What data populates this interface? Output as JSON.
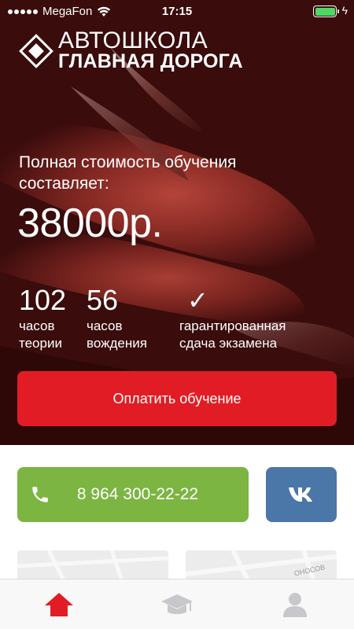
{
  "status_bar": {
    "carrier": "MegaFon",
    "time": "17:15",
    "battery_level": 1.0
  },
  "logo": {
    "line1": "АВТОШКОЛА",
    "line2": "ГЛАВНАЯ ДОРОГА"
  },
  "hero": {
    "cost_label": "Полная стоимость обучения составляет:",
    "price": "38000р.",
    "stats": [
      {
        "value": "102",
        "label": "часов\nтеории"
      },
      {
        "value": "56",
        "label": "часов\nвождения"
      },
      {
        "value": "✓",
        "label": "гарантированная\nсдача экзамена"
      }
    ],
    "pay_button_label": "Оплатить обучение"
  },
  "contact": {
    "phone": "8 964 300-22-22",
    "vk_label": "VK"
  },
  "colors": {
    "pay_button": "#e21c24",
    "phone_button": "#7cb542",
    "vk_button": "#4a76a8",
    "active_tab": "#e21c24",
    "inactive_tab": "#c7c7cc"
  },
  "tabbar": {
    "items": [
      {
        "icon": "home-icon",
        "active": true
      },
      {
        "icon": "graduation-cap-icon",
        "active": false
      },
      {
        "icon": "user-icon",
        "active": false
      }
    ]
  },
  "map_street_fragment": "ОНОСОВ"
}
